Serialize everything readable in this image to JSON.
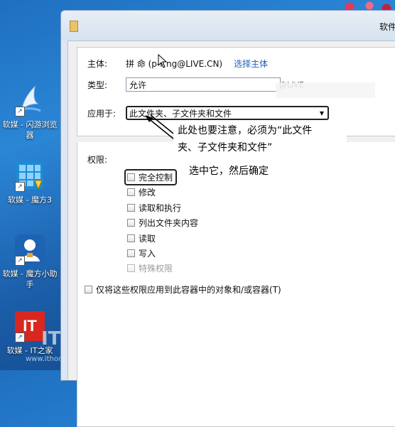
{
  "desktop": {
    "icons": [
      {
        "label": "软媒 - 闪游浏览器",
        "icon": "browser-icon"
      },
      {
        "label": "软媒 - 魔方3",
        "icon": "cube-icon"
      },
      {
        "label": "软媒 - 魔方小助手",
        "icon": "assistant-icon"
      },
      {
        "label": "软媒 - IT之家",
        "icon": "ithome-icon"
      }
    ],
    "watermark_url": "www.ithome.com",
    "watermark_logo": "IT 家"
  },
  "window": {
    "title": "软件"
  },
  "principal": {
    "label": "主体:",
    "value": "拼 命 (p-r    ng@LIVE.CN)",
    "select_link": "选择主体"
  },
  "type": {
    "label": "类型:",
    "value": "允许",
    "suffix": "@LIVE"
  },
  "applies_to": {
    "label": "应用于:",
    "value": "此文件夹、子文件夹和文件"
  },
  "annotations": {
    "note1": "此处也要注意，必须为“此文件夹、子文件夹和文件”",
    "note1_line1": "此处也要注意，必须为“此文件",
    "note1_line2": "夹、子文件夹和文件”",
    "note2": "选中它，然后确定"
  },
  "permissions": {
    "label": "权限:",
    "items": [
      {
        "label": "完全控制",
        "checked": false,
        "disabled": false
      },
      {
        "label": "修改",
        "checked": false,
        "disabled": false
      },
      {
        "label": "读取和执行",
        "checked": false,
        "disabled": false
      },
      {
        "label": "列出文件夹内容",
        "checked": false,
        "disabled": false
      },
      {
        "label": "读取",
        "checked": false,
        "disabled": false
      },
      {
        "label": "写入",
        "checked": false,
        "disabled": false
      },
      {
        "label": "特殊权限",
        "checked": false,
        "disabled": true
      }
    ]
  },
  "apply_only": {
    "label": "仅将这些权限应用到此容器中的对象和/或容器",
    "hotkey": "(T)",
    "checked": false
  }
}
